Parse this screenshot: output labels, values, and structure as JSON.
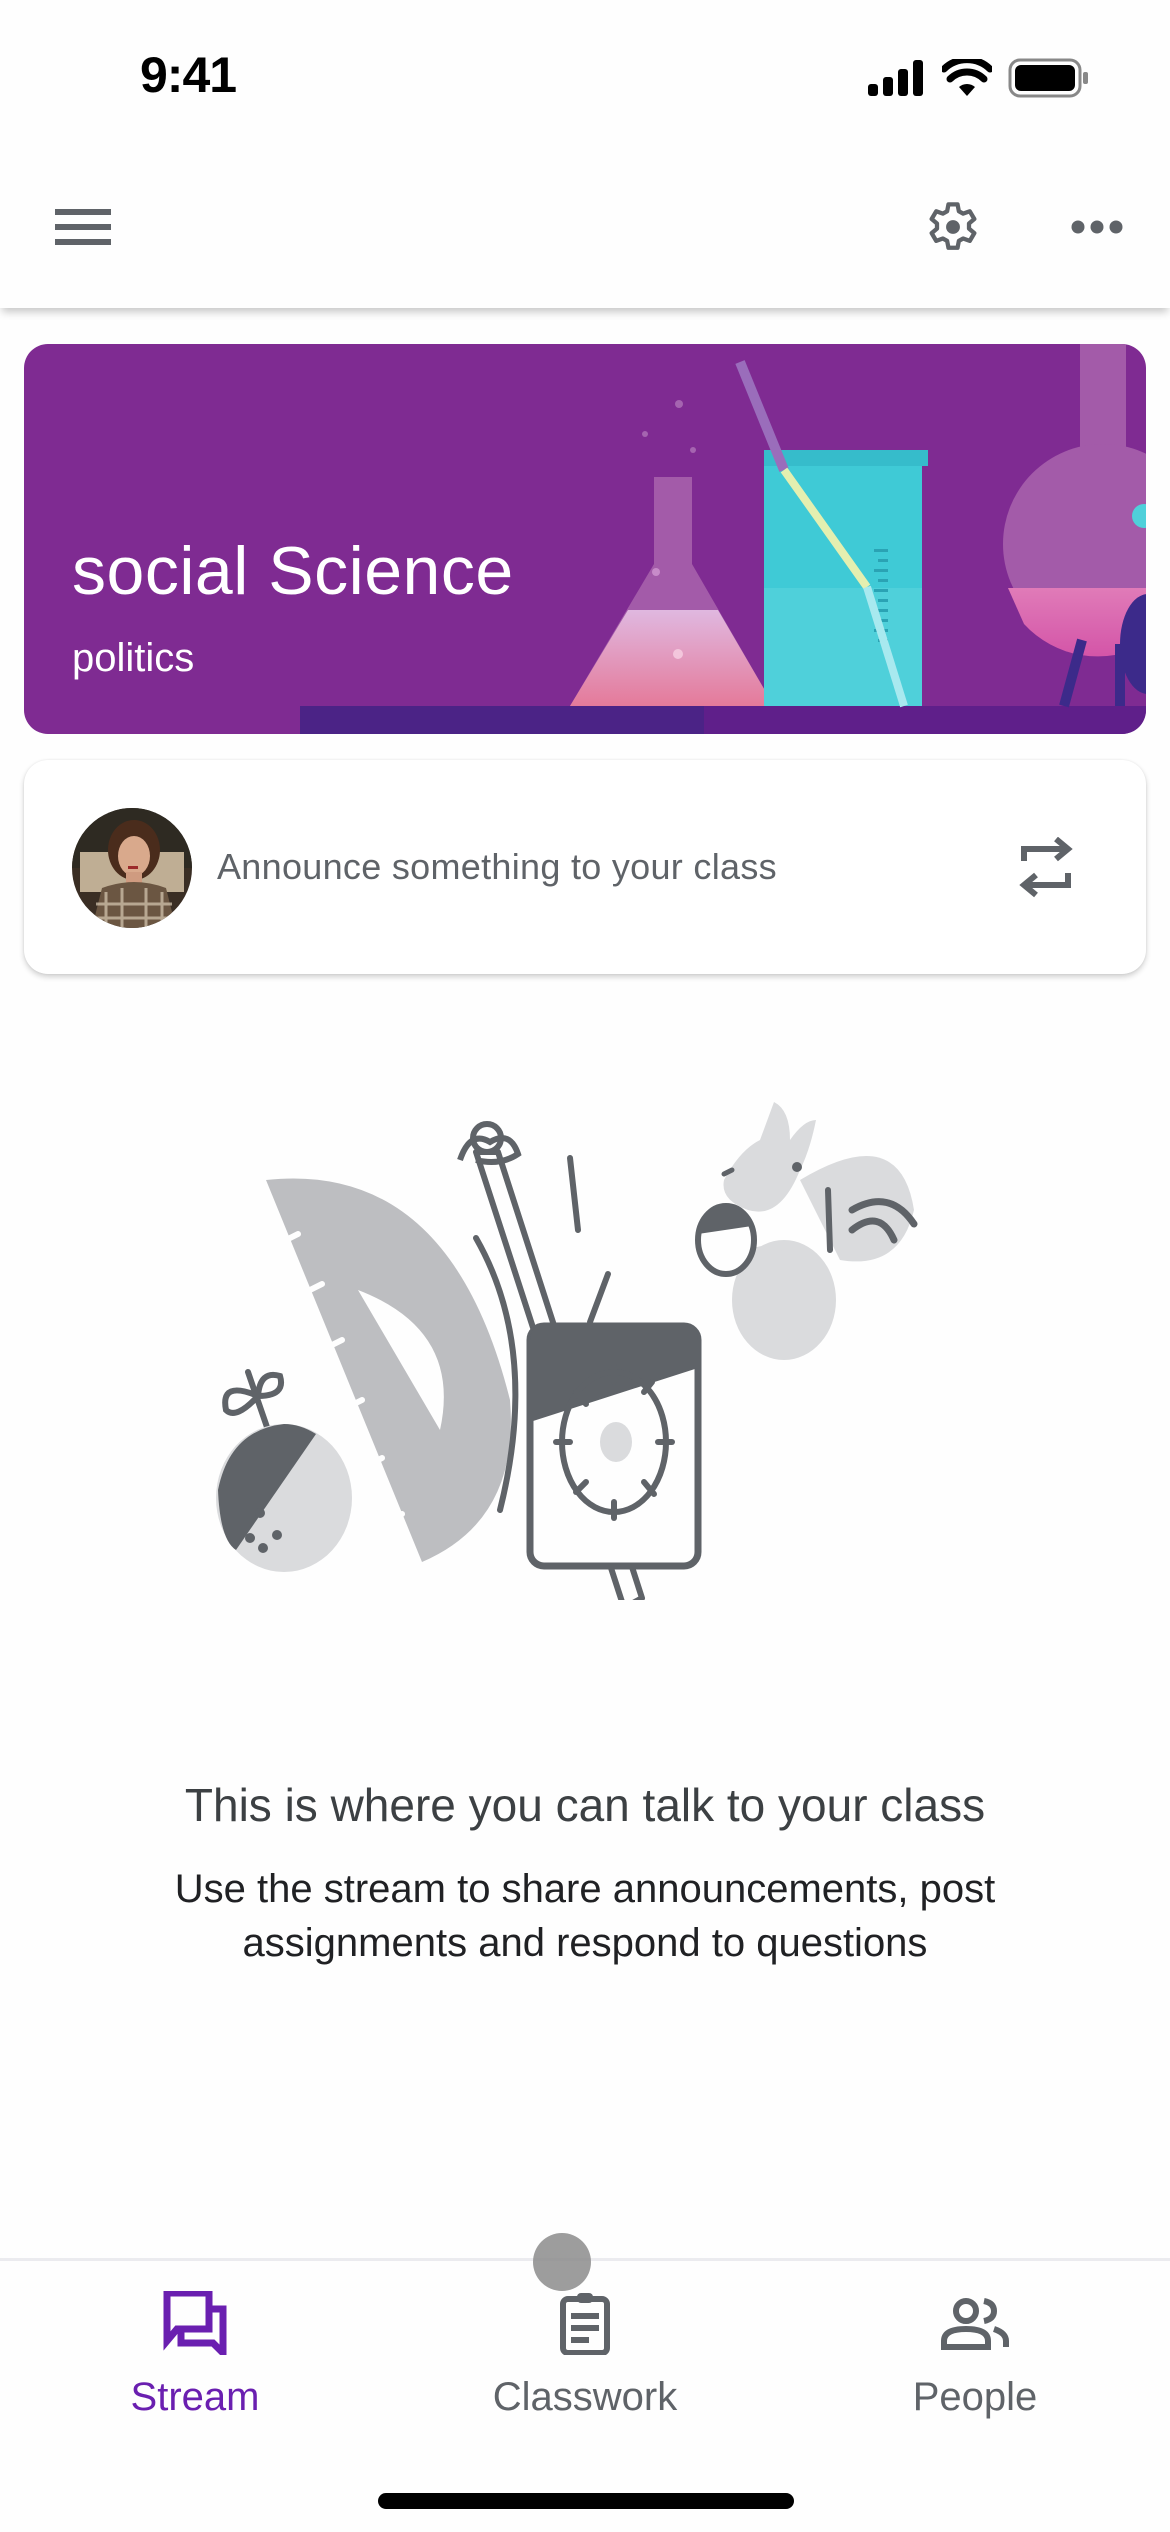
{
  "status_bar": {
    "time": "9:41",
    "icons": [
      "signal-icon",
      "wifi-icon",
      "battery-icon"
    ]
  },
  "app_bar": {
    "left_icon": "menu-icon",
    "right_icons": [
      "gear-icon",
      "more-horizontal-icon"
    ]
  },
  "class_banner": {
    "title": "social Science",
    "section": "politics",
    "background_color": "#7f2b92",
    "theme": "science-lab-beakers"
  },
  "announce": {
    "placeholder": "Announce something to your class",
    "avatar": "user-avatar",
    "action_icon": "repost-icon"
  },
  "empty_state": {
    "illustration": "protractor-pencil-squirrel-illustration",
    "title": "This is where you can talk to your class",
    "description": "Use the stream to share announcements, post assignments and respond to questions"
  },
  "bottom_nav": {
    "items": [
      {
        "label": "Stream",
        "icon": "stream-icon",
        "active": true
      },
      {
        "label": "Classwork",
        "icon": "classwork-icon",
        "active": false
      },
      {
        "label": "People",
        "icon": "people-icon",
        "active": false
      }
    ],
    "active_color": "#6a1fb0",
    "inactive_color": "#5f6368"
  }
}
